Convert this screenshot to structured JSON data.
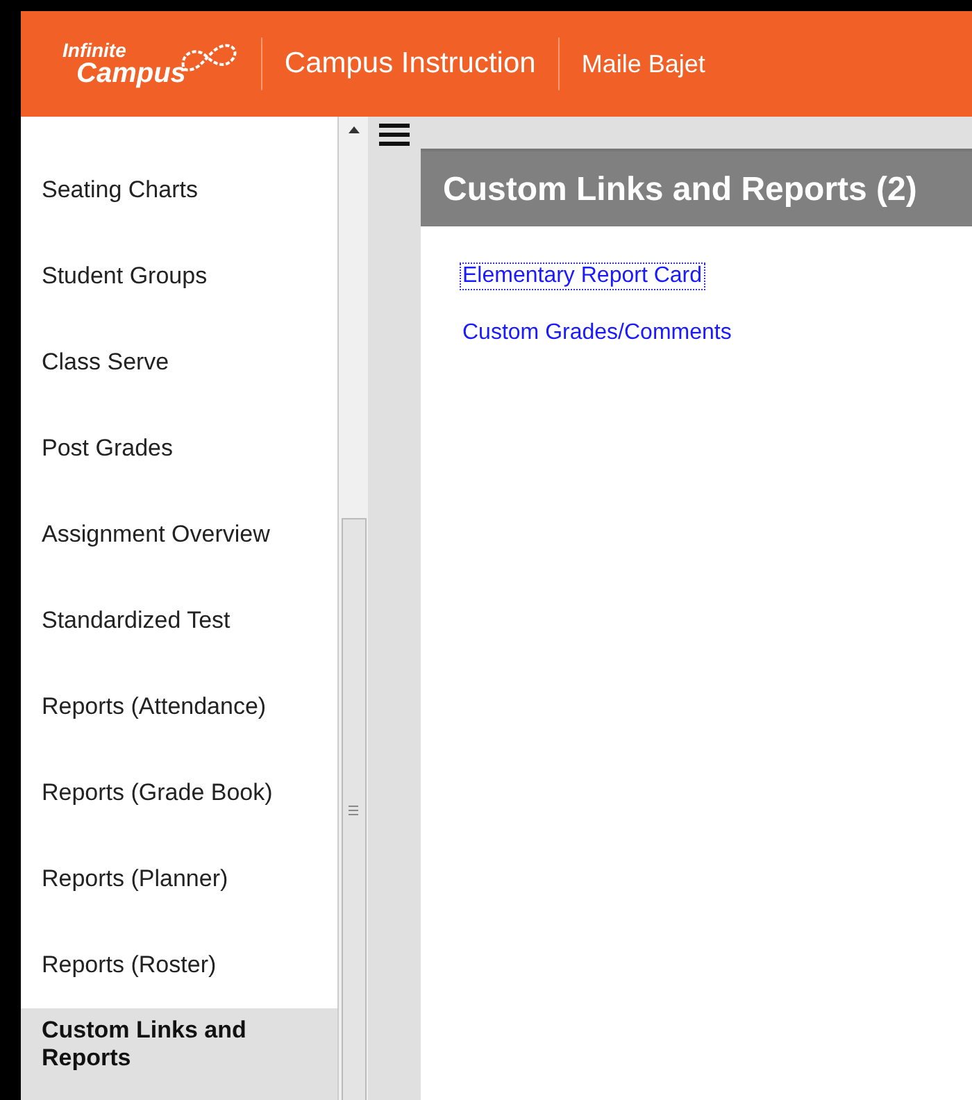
{
  "header": {
    "logo_top": "Infinite",
    "logo_bottom": "Campus",
    "app_title": "Campus Instruction",
    "user": "Maile Bajet"
  },
  "sidebar": {
    "items": [
      {
        "label": "Seating Charts",
        "selected": false
      },
      {
        "label": "Student Groups",
        "selected": false
      },
      {
        "label": "Class Serve",
        "selected": false
      },
      {
        "label": "Post Grades",
        "selected": false
      },
      {
        "label": "Assignment Overview",
        "selected": false
      },
      {
        "label": "Standardized Test",
        "selected": false
      },
      {
        "label": "Reports (Attendance)",
        "selected": false
      },
      {
        "label": "Reports (Grade Book)",
        "selected": false
      },
      {
        "label": "Reports (Planner)",
        "selected": false
      },
      {
        "label": "Reports (Roster)",
        "selected": false
      },
      {
        "label": "Custom Links and Reports",
        "selected": true
      }
    ]
  },
  "content": {
    "title": "Custom Links and Reports (2)",
    "links": [
      {
        "label": "Elementary Report Card",
        "focused": true
      },
      {
        "label": "Custom Grades/Comments",
        "focused": false
      }
    ]
  }
}
